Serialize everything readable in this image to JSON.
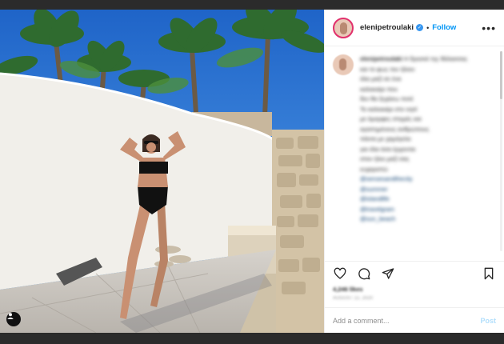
{
  "post": {
    "username": "elenipetroulaki",
    "follow_label": "Follow",
    "separator": "•",
    "more_label": "•••",
    "verified_glyph": "✓",
    "caption": {
      "username": "elenipetroulaki",
      "lines": [
        "Η δροσιά της θάλασσας",
        "και το φως του ήλιου",
        "όλα μαζί σε ένα",
        "καλοκαίρι που",
        "δεν θα ξεχάσω ποτέ",
        "Το καλοκαίρι στο νησί",
        "με όμορφες στιγμές και",
        "αγαπημένους ανθρώπους",
        "πάντα με χαμόγελο",
        "για όλα όσα έρχονται",
        "στον ήλιο μαζί σας",
        "ευχαριστώ"
      ],
      "tags": [
        "@sensesandthecity",
        "@summer",
        "@islandlife",
        "@travelgram",
        "@sun_beach"
      ]
    },
    "likes": "4,246 likes",
    "time": "August 12, 2020",
    "comment_placeholder": "Add a comment...",
    "post_label": "Post"
  },
  "icons": {
    "like": "heart-icon",
    "comment": "comment-icon",
    "share": "share-icon",
    "save": "bookmark-icon",
    "more": "more-icon",
    "tag": "user-tag-icon"
  },
  "colors": {
    "accent": "#0095f6",
    "verified": "#3897f0",
    "sky": "#3e7fd6"
  }
}
